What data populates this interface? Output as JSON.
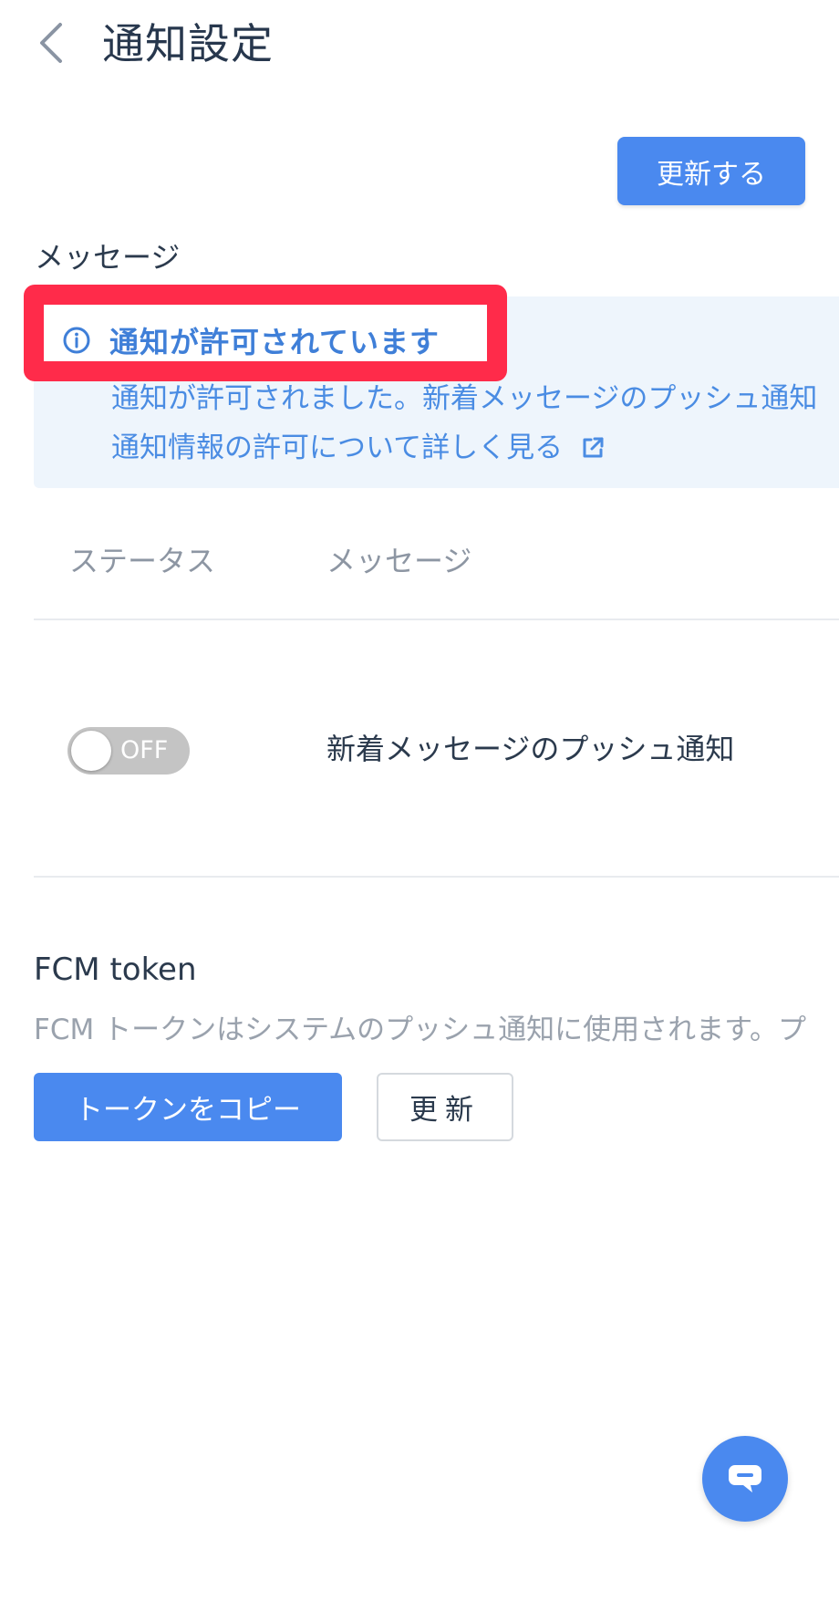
{
  "header": {
    "title": "通知設定"
  },
  "toolbar": {
    "update_label": "更新する"
  },
  "section": {
    "label": "メッセージ"
  },
  "info": {
    "title": "通知が許可されています",
    "description": "通知が許可されました。新着メッセージのプッシュ通知",
    "link_text": "通知情報の許可について詳しく見る"
  },
  "table": {
    "headers": [
      "ステータス",
      "メッセージ"
    ],
    "rows": [
      {
        "toggle_state": "OFF",
        "label": "新着メッセージのプッシュ通知"
      }
    ]
  },
  "fcm": {
    "title": "FCM token",
    "description": "FCM トークンはシステムのプッシュ通知に使用されます。プ",
    "copy_label": "トークンをコピー",
    "refresh_label": "更新"
  },
  "colors": {
    "accent": "#4a89ef",
    "info_text": "#3f7fd8",
    "info_bg": "#eef5fc",
    "highlight": "#ff2b4a",
    "toggle_off": "#c4c4c4"
  },
  "icons": [
    "chevron-left-icon",
    "info-icon",
    "external-link-icon",
    "chat-icon"
  ]
}
